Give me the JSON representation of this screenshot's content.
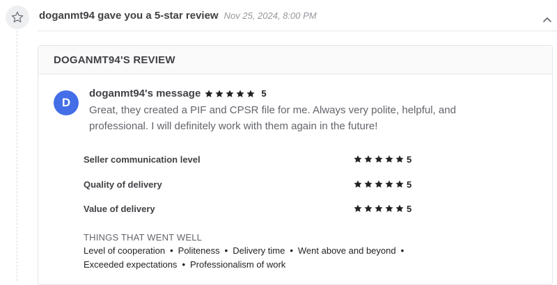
{
  "header": {
    "title": "doganmt94 gave you a 5-star review",
    "date": "Nov 25, 2024, 8:00 PM"
  },
  "review_card": {
    "heading": "DOGANMT94'S REVIEW",
    "avatar_initial": "D",
    "avatar_color": "#446ee7",
    "message_title": "doganmt94's message",
    "overall_rating": 5,
    "overall_score_label": "5",
    "message_text": "Great, they created a PIF and CPSR file for me. Always very polite, helpful, and professional. I will definitely work with them again in the future!",
    "ratings": [
      {
        "label": "Seller communication level",
        "value": 5,
        "score_label": "5"
      },
      {
        "label": "Quality of delivery",
        "value": 5,
        "score_label": "5"
      },
      {
        "label": "Value of delivery",
        "value": 5,
        "score_label": "5"
      }
    ],
    "went_well_title": "THINGS THAT WENT WELL",
    "went_well_items": [
      "Level of cooperation",
      "Politeness",
      "Delivery time",
      "Went above and beyond",
      "Exceeded expectations",
      "Professionalism of work"
    ]
  },
  "colors": {
    "star_color": "#222325",
    "text_primary": "#404145",
    "text_secondary": "#62646a"
  },
  "icons": {
    "timeline": "star-outline-icon",
    "collapse": "chevron-up-icon",
    "rating": "star-filled-icon"
  }
}
